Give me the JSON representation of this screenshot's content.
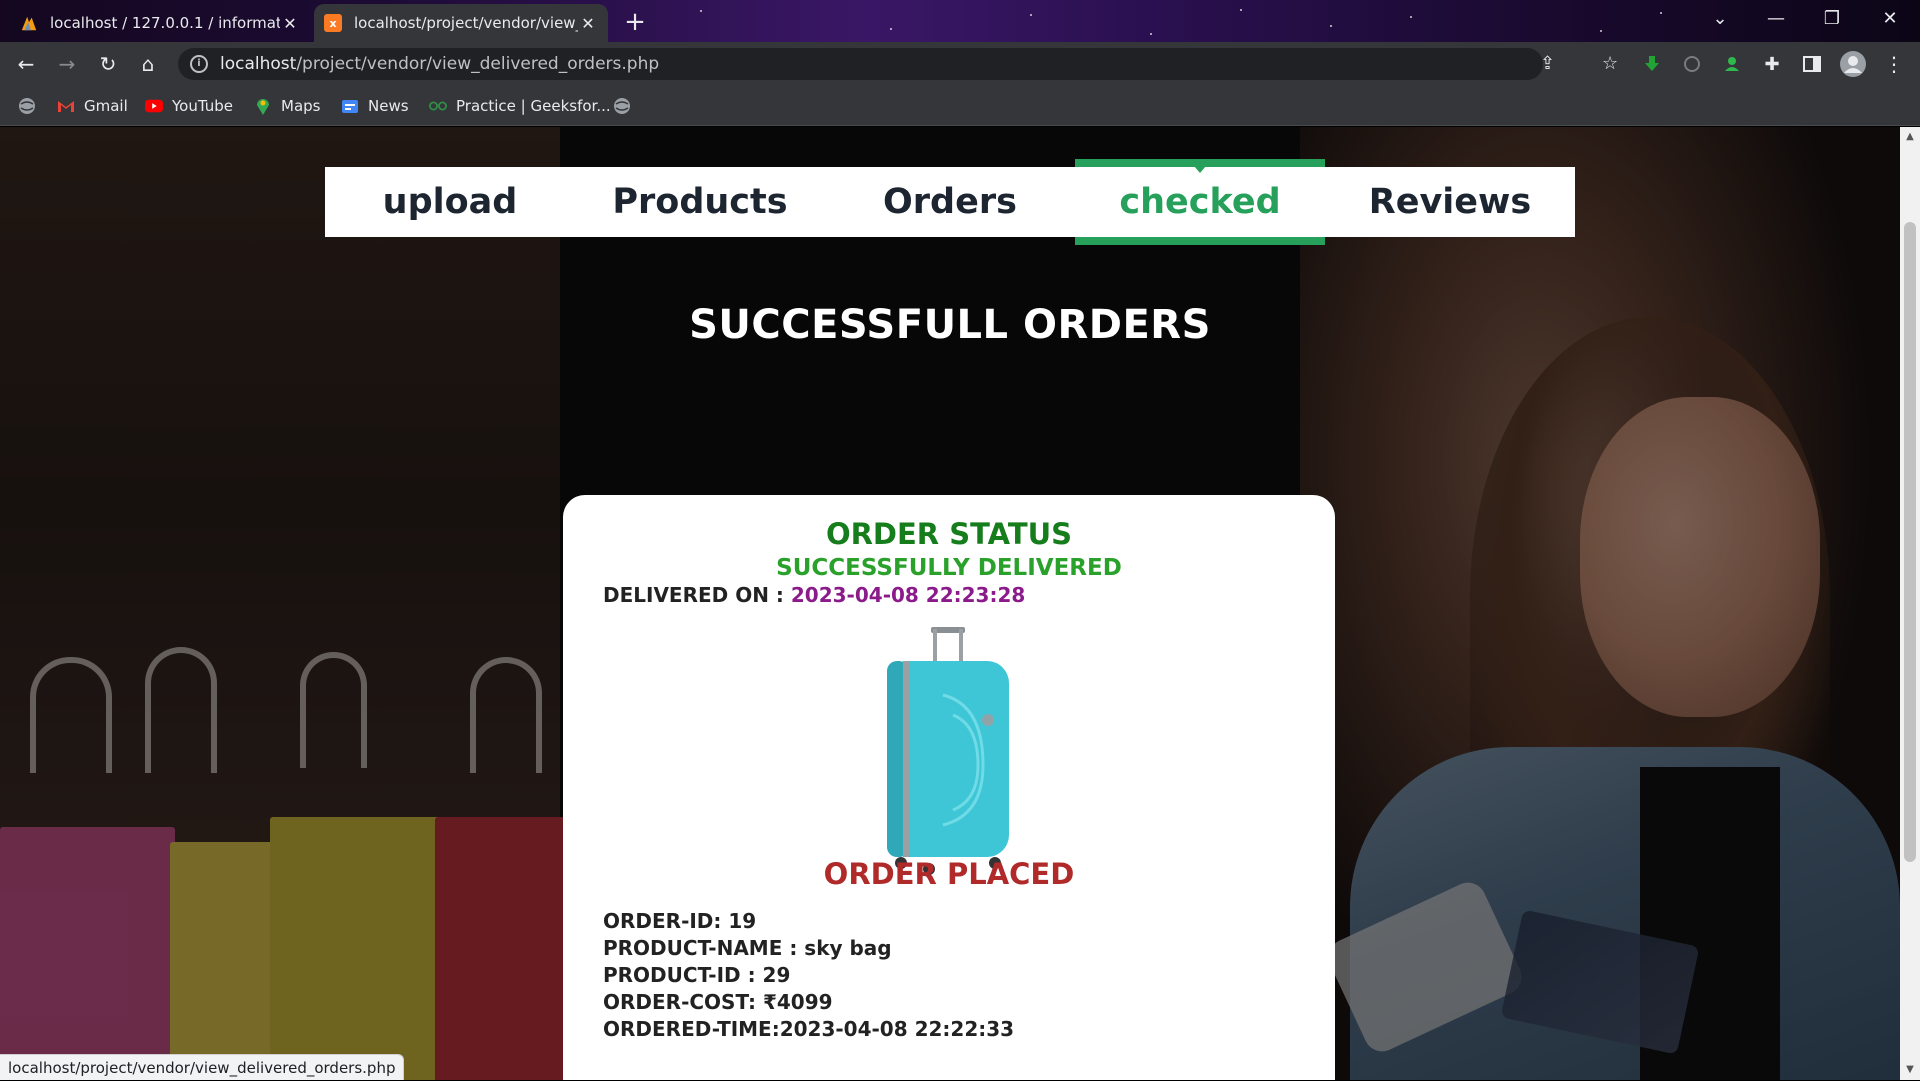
{
  "browser": {
    "tabs": [
      {
        "title": "localhost / 127.0.0.1 / information",
        "icon": "phpmyadmin-icon",
        "active": false
      },
      {
        "title": "localhost/project/vendor/view_delivered_orders.php",
        "icon": "xampp-icon",
        "active": true
      }
    ],
    "new_tab_label": "+",
    "url_host": "localhost",
    "url_path": "/project/vendor/view_delivered_orders.php",
    "bookmarks": [
      {
        "label": "",
        "icon": "globe-icon"
      },
      {
        "label": "Gmail",
        "icon": "gmail-icon"
      },
      {
        "label": "YouTube",
        "icon": "youtube-icon"
      },
      {
        "label": "Maps",
        "icon": "maps-icon"
      },
      {
        "label": "News",
        "icon": "news-icon"
      },
      {
        "label": "Practice | Geeksfor...",
        "icon": "geeksforgeeks-icon"
      },
      {
        "label": "",
        "icon": "globe-icon"
      }
    ],
    "status_url": "localhost/project/vendor/view_delivered_orders.php"
  },
  "nav": {
    "items": [
      {
        "label": "upload",
        "active": false
      },
      {
        "label": "Products",
        "active": false
      },
      {
        "label": "Orders",
        "active": false
      },
      {
        "label": "checked",
        "active": true
      },
      {
        "label": "Reviews",
        "active": false
      }
    ]
  },
  "page": {
    "heading": "SUCCESSFULL ORDERS"
  },
  "order": {
    "status_title": "ORDER STATUS",
    "status_value": "SUCCESSFULLY DELIVERED",
    "delivered_label": "DELIVERED ON : ",
    "delivered_value": "2023-04-08 22:23:28",
    "placed_title": "ORDER PLACED",
    "details": [
      "ORDER-ID: 19",
      "PRODUCT-NAME : sky bag",
      "PRODUCT-ID : 29",
      "ORDER-COST: ₹4099",
      "ORDERED-TIME:2023-04-08 22:22:33"
    ]
  },
  "colors": {
    "active_nav": "#27a05b",
    "status_title": "#167d1c",
    "status_value": "#2aa12a",
    "delivered_date": "#8b1b8b",
    "placed_title": "#b12a2a"
  }
}
